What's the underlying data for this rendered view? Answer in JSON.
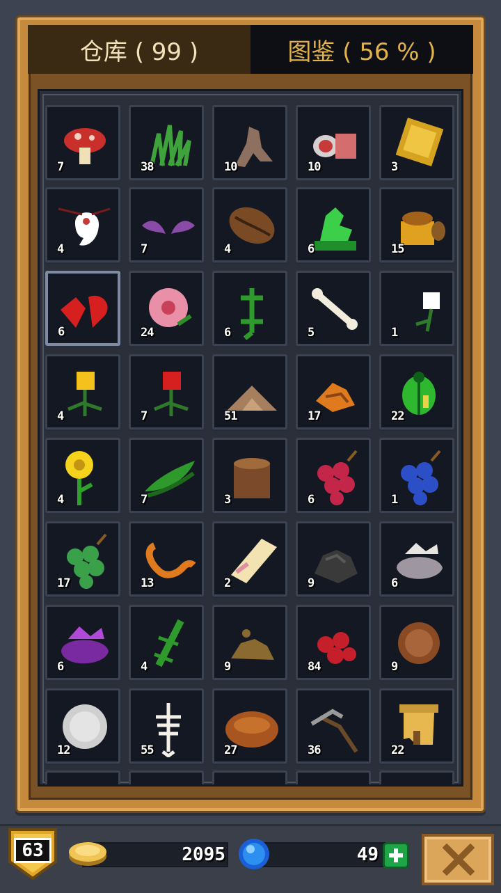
{
  "tabs": {
    "storage_label": "仓库 ( 99 )",
    "catalog_label": "图鉴 ( 56 % )"
  },
  "items": [
    {
      "icon": "mushroom-icon",
      "count": "7"
    },
    {
      "icon": "grass-icon",
      "count": "38"
    },
    {
      "icon": "dry-root-icon",
      "count": "10"
    },
    {
      "icon": "raw-meat-icon",
      "count": "10"
    },
    {
      "icon": "gold-card-icon",
      "count": "3"
    },
    {
      "icon": "ghost-charm-icon",
      "count": "4"
    },
    {
      "icon": "bat-wing-icon",
      "count": "7"
    },
    {
      "icon": "coffee-bean-icon",
      "count": "4"
    },
    {
      "icon": "jade-dragon-statue-icon",
      "count": "6"
    },
    {
      "icon": "honey-pot-icon",
      "count": "15"
    },
    {
      "icon": "red-heart-fragment-icon",
      "count": "6"
    },
    {
      "icon": "pink-flower-icon",
      "count": "24"
    },
    {
      "icon": "green-lizard-icon",
      "count": "6"
    },
    {
      "icon": "bone-icon",
      "count": "5"
    },
    {
      "icon": "white-flower-icon",
      "count": "1"
    },
    {
      "icon": "yellow-flower-icon",
      "count": "4"
    },
    {
      "icon": "red-flower-icon",
      "count": "7"
    },
    {
      "icon": "dirt-pile-icon",
      "count": "51"
    },
    {
      "icon": "orange-leaves-icon",
      "count": "17"
    },
    {
      "icon": "green-beetle-icon",
      "count": "22"
    },
    {
      "icon": "sunflower-icon",
      "count": "4"
    },
    {
      "icon": "green-pea-pod-icon",
      "count": "7"
    },
    {
      "icon": "tree-stump-icon",
      "count": "3"
    },
    {
      "icon": "red-grapes-icon",
      "count": "6"
    },
    {
      "icon": "blue-grapes-icon",
      "count": "1"
    },
    {
      "icon": "green-grapes-icon",
      "count": "17"
    },
    {
      "icon": "orange-worm-icon",
      "count": "13"
    },
    {
      "icon": "paper-scroll-icon",
      "count": "2"
    },
    {
      "icon": "coal-ore-icon",
      "count": "9"
    },
    {
      "icon": "grey-egg-icon",
      "count": "6"
    },
    {
      "icon": "purple-egg-icon",
      "count": "6"
    },
    {
      "icon": "green-gecko-icon",
      "count": "4"
    },
    {
      "icon": "brown-dust-icon",
      "count": "9"
    },
    {
      "icon": "red-berries-icon",
      "count": "84"
    },
    {
      "icon": "bronze-coin-icon",
      "count": "9"
    },
    {
      "icon": "silver-coin-icon",
      "count": "12"
    },
    {
      "icon": "skeleton-icon",
      "count": "55"
    },
    {
      "icon": "brown-nest-icon",
      "count": "27"
    },
    {
      "icon": "pickaxe-icon",
      "count": "36"
    },
    {
      "icon": "old-scroll-icon",
      "count": "22"
    }
  ],
  "bottom_bar": {
    "level": "63",
    "gold": "2095",
    "gems": "49"
  },
  "colors": {
    "frame": "#c58a3e",
    "panel": "#2a2f3a",
    "slot": "#141823",
    "catalog_tab_text": "#e2b24a"
  }
}
